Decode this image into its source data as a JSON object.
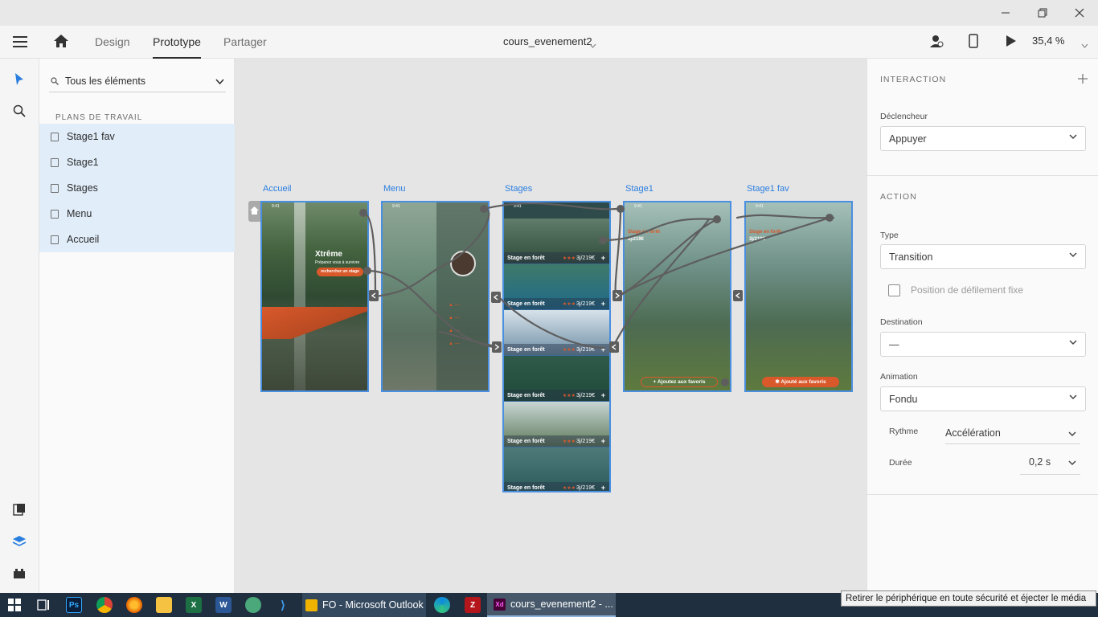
{
  "app": {
    "tabs": [
      "Design",
      "Prototype",
      "Partager"
    ],
    "active_tab": "Prototype",
    "document_title": "cours_evenement2",
    "zoom": "35,4 %"
  },
  "layers_panel": {
    "search_placeholder": "Tous les éléments",
    "section_title": "PLANS DE TRAVAIL",
    "artboards": [
      "Stage1 fav",
      "Stage1",
      "Stages",
      "Menu",
      "Accueil"
    ]
  },
  "canvas": {
    "artboard_labels": [
      "Accueil",
      "Menu",
      "Stages",
      "Stage1",
      "Stage1 fav"
    ],
    "accueil": {
      "title": "Xtrême",
      "subtitle": "Préparez vous à survivre",
      "button": "rechercher un stage"
    },
    "stages": {
      "items": [
        {
          "label": "Stage en forêt",
          "stars": "★★★",
          "price": "3j/219€"
        },
        {
          "label": "Stage en forêt",
          "stars": "★★★",
          "price": "3j/219€"
        },
        {
          "label": "Stage en forêt",
          "stars": "★★★",
          "price": "3j/219€"
        },
        {
          "label": "Stage en forêt",
          "stars": "★★★",
          "price": "3j/219€"
        },
        {
          "label": "Stage en forêt",
          "stars": "★★★",
          "price": "3j/219€"
        },
        {
          "label": "Stage en forêt",
          "stars": "★★★",
          "price": "3j/219€"
        }
      ]
    },
    "stage1": {
      "title": "Stage en forêt",
      "price": "3j/219€",
      "button": "Ajoutez aux favoris"
    },
    "stage1fav": {
      "title": "Stage en forêt",
      "price": "3j/219€",
      "button": "Ajouté aux favoris"
    }
  },
  "inspector": {
    "interaction_title": "INTERACTION",
    "trigger_label": "Déclencheur",
    "trigger_value": "Appuyer",
    "action_title": "ACTION",
    "type_label": "Type",
    "type_value": "Transition",
    "fixed_scroll_label": "Position de défilement fixe",
    "destination_label": "Destination",
    "destination_value": "—",
    "animation_label": "Animation",
    "animation_value": "Fondu",
    "rhythm_label": "Rythme",
    "rhythm_value": "Accélération",
    "duration_label": "Durée",
    "duration_value": "0,2 s"
  },
  "taskbar": {
    "tasks": [
      "FO - Microsoft Outlook",
      "cours_evenement2 - ..."
    ],
    "tooltip": "Retirer le périphérique en toute sécurité et éjecter le média"
  },
  "colors": {
    "accent": "#2a7ee0",
    "orange": "#d9592b",
    "taskbar": "#1f2f3f"
  }
}
